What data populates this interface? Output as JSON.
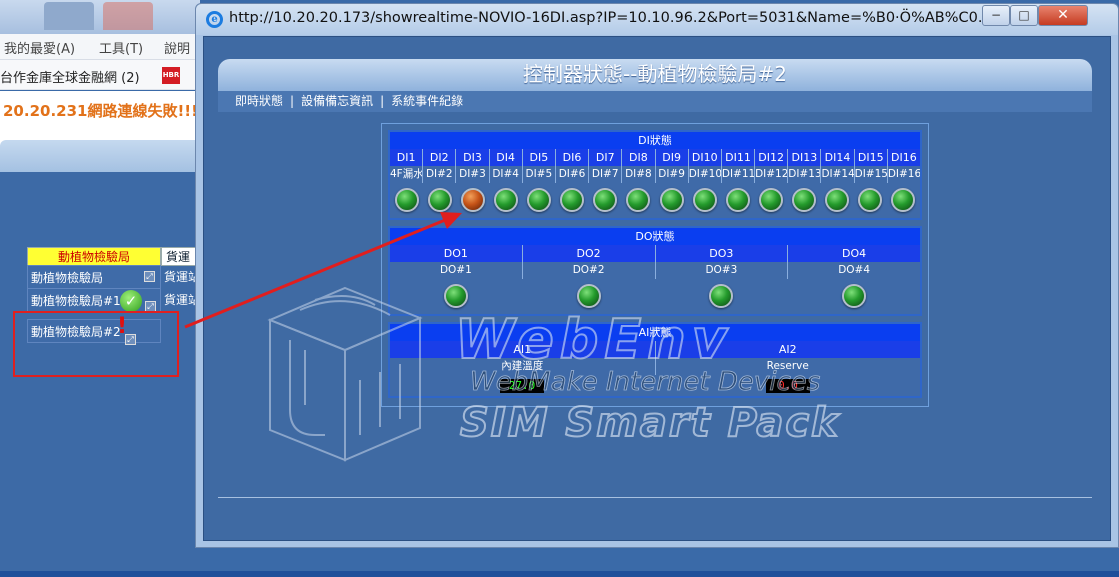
{
  "background": {
    "menu": {
      "favorites": "我的最愛(A)",
      "tools": "工具(T)",
      "help": "說明"
    },
    "favorites_bar": {
      "item": "台作金庫全球金融網 (2)",
      "hbr_icon_text": "HBR"
    },
    "status_message": "20.20.231網路連線失敗!!!",
    "device_table": {
      "header": "動植物檢驗局",
      "header2": "貨運",
      "rows": [
        {
          "label": "動植物檢驗局"
        },
        {
          "label": "動植物檢驗局#1"
        },
        {
          "label": "動植物檢驗局#2"
        }
      ],
      "col2_rows": [
        "貨運站",
        "貨運站"
      ]
    }
  },
  "popup": {
    "url": "http://10.20.20.173/showrealtime-NOVIO-16DI.asp?IP=10.10.96.2&Port=5031&Name=%B0·Ö%AB%C0...",
    "window_buttons": {
      "minimize": "−",
      "maximize": "□",
      "close": "✕"
    },
    "banner_title": "控制器狀態--動植物檢驗局#2",
    "nav": {
      "realtime": "即時狀態",
      "separator": "|",
      "equipment": "設備備忘資訊",
      "events": "系統事件紀錄"
    },
    "di": {
      "title": "DI狀態",
      "channels": [
        "DI1",
        "DI2",
        "DI3",
        "DI4",
        "DI5",
        "DI6",
        "DI7",
        "DI8",
        "DI9",
        "DI10",
        "DI11",
        "DI12",
        "DI13",
        "DI14",
        "DI15",
        "DI16"
      ],
      "names": [
        "4F漏水",
        "DI#2",
        "DI#3",
        "DI#4",
        "DI#5",
        "DI#6",
        "DI#7",
        "DI#8",
        "DI#9",
        "DI#10",
        "DI#11",
        "DI#12",
        "DI#13",
        "DI#14",
        "DI#15",
        "DI#16"
      ],
      "states": [
        "green",
        "green",
        "red",
        "green",
        "green",
        "green",
        "green",
        "green",
        "green",
        "green",
        "green",
        "green",
        "green",
        "green",
        "green",
        "green"
      ]
    },
    "do": {
      "title": "DO狀態",
      "channels": [
        "DO1",
        "DO2",
        "DO3",
        "DO4"
      ],
      "names": [
        "DO#1",
        "DO#2",
        "DO#3",
        "DO#4"
      ],
      "states": [
        "green",
        "green",
        "green",
        "green"
      ]
    },
    "ai": {
      "title": "AI狀態",
      "channels": [
        "AI1",
        "AI2"
      ],
      "names": [
        "內建溫度",
        "Reserve"
      ],
      "values": [
        "27.0",
        "0.0"
      ]
    },
    "watermark": {
      "line1": "WebEnv",
      "line2": "WebMake Internet Devices",
      "line3": "SIM Smart Pack"
    }
  },
  "colors": {
    "led_on": "#249b2c",
    "led_alarm": "#c65418",
    "header_blue": "#0a3ef0",
    "client_blue": "#3f6aa3",
    "arrow_red": "#e01e1e"
  }
}
